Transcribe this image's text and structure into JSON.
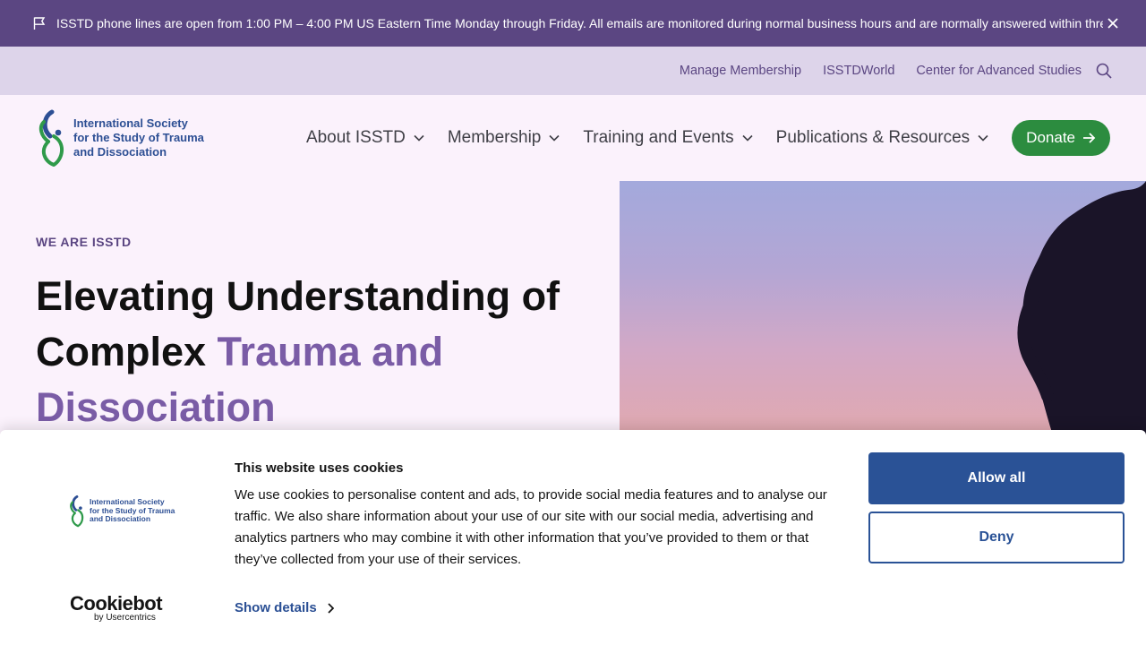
{
  "announcement": {
    "message": "ISSTD phone lines are open from 1:00 PM – 4:00 PM US Eastern Time Monday through Friday. All emails are monitored during normal business hours and are normally answered within three business days.",
    "flag_icon": "flag-icon",
    "close_icon": "close-icon"
  },
  "utility_nav": {
    "links": [
      "Manage Membership",
      "ISSTDWorld",
      "Center for Advanced Studies"
    ],
    "search_icon": "search-icon"
  },
  "logo": {
    "line1": "International Society",
    "line2": "for the Study of Trauma",
    "line3": "and Dissociation"
  },
  "main_nav": {
    "items": [
      "About ISSTD",
      "Membership",
      "Training and Events",
      "Publications & Resources"
    ],
    "donate_label": "Donate"
  },
  "hero": {
    "eyebrow": "WE ARE ISSTD",
    "title_part1": "Elevating Understanding of Complex ",
    "title_accent": "Trauma and Dissociation"
  },
  "cookie_banner": {
    "title": "This website uses cookies",
    "body": "We use cookies to personalise content and ads, to provide social media features and to analyse our traffic. We also share information about your use of our site with our social media, advertising and analytics partners who may combine it with other information that you’ve provided to them or that they’ve collected from your use of their services.",
    "show_details": "Show details",
    "allow_all": "Allow all",
    "deny": "Deny",
    "brand_name": "Cookiebot",
    "brand_sub": "by Usercentrics"
  },
  "colors": {
    "announce_bg": "#5b4682",
    "utility_bg": "#ddd4ea",
    "page_bg": "#fbf2fc",
    "accent_purple": "#7a5ca6",
    "donate_green": "#2c8c3f",
    "cookie_blue": "#2a5296",
    "logo_blue": "#2d4f94",
    "logo_green": "#2f9a4a"
  }
}
